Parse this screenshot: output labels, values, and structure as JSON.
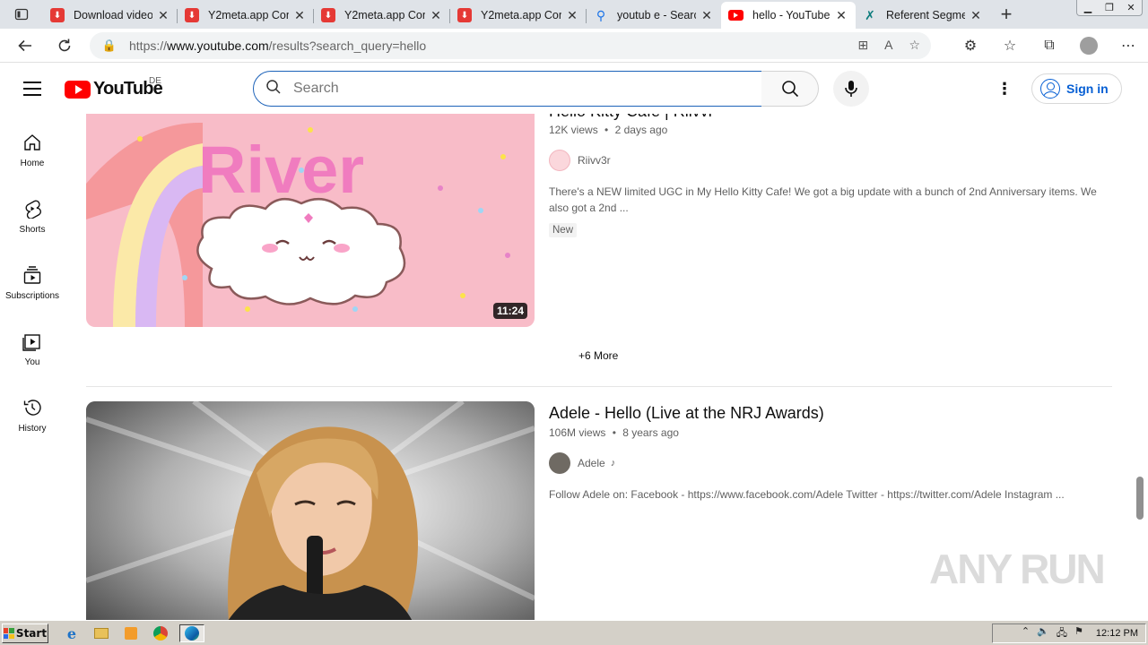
{
  "browser": {
    "tabs": [
      {
        "label": "Download video",
        "favicon": "download-icon",
        "color": "#e53935"
      },
      {
        "label": "Y2meta.app Con",
        "favicon": "download-icon",
        "color": "#e53935"
      },
      {
        "label": "Y2meta.app Con",
        "favicon": "download-icon",
        "color": "#e53935"
      },
      {
        "label": "Y2meta.app Con",
        "favicon": "download-icon",
        "color": "#e53935"
      },
      {
        "label": "youtub e - Searc",
        "favicon": "search-icon",
        "color": "#1a73e8"
      },
      {
        "label": "hello - YouTube",
        "favicon": "youtube-icon",
        "color": "#ff0000"
      },
      {
        "label": "Referent Segme",
        "favicon": "xing-icon",
        "color": "#0a7b7b"
      }
    ],
    "url_prefix": "https://",
    "url_host": "www.youtube.com",
    "url_path": "/results?search_query=hello"
  },
  "youtube": {
    "logo_text": "YouTube",
    "region": "DE",
    "search_placeholder": "Search",
    "signin_label": "Sign in",
    "sidebar": [
      {
        "label": "Home",
        "icon": "home-icon"
      },
      {
        "label": "Shorts",
        "icon": "shorts-icon"
      },
      {
        "label": "Subscriptions",
        "icon": "subscriptions-icon"
      },
      {
        "label": "You",
        "icon": "you-icon"
      },
      {
        "label": "History",
        "icon": "history-icon"
      }
    ],
    "results": [
      {
        "title": "Hello Kitty Cafe | Riivvr",
        "views": "12K views",
        "age": "2 days ago",
        "channel": "Riivv3r",
        "description": "There's a NEW limited UGC in My Hello Kitty Cafe! We got a big update with a bunch of 2nd Anniversary items. We also got a 2nd ...",
        "badge": "New",
        "duration": "11:24",
        "thumb_text": "River"
      },
      {
        "title": "Adele - Hello (Live at the NRJ Awards)",
        "views": "106M views",
        "age": "8 years ago",
        "channel": "Adele",
        "description": "Follow Adele on: Facebook - https://www.facebook.com/Adele Twitter - https://twitter.com/Adele Instagram ..."
      }
    ],
    "more_label": "+6 More",
    "meta_sep": "•"
  },
  "watermark": "ANY RUN",
  "taskbar": {
    "start_label": "Start",
    "clock": "12:12 PM"
  }
}
